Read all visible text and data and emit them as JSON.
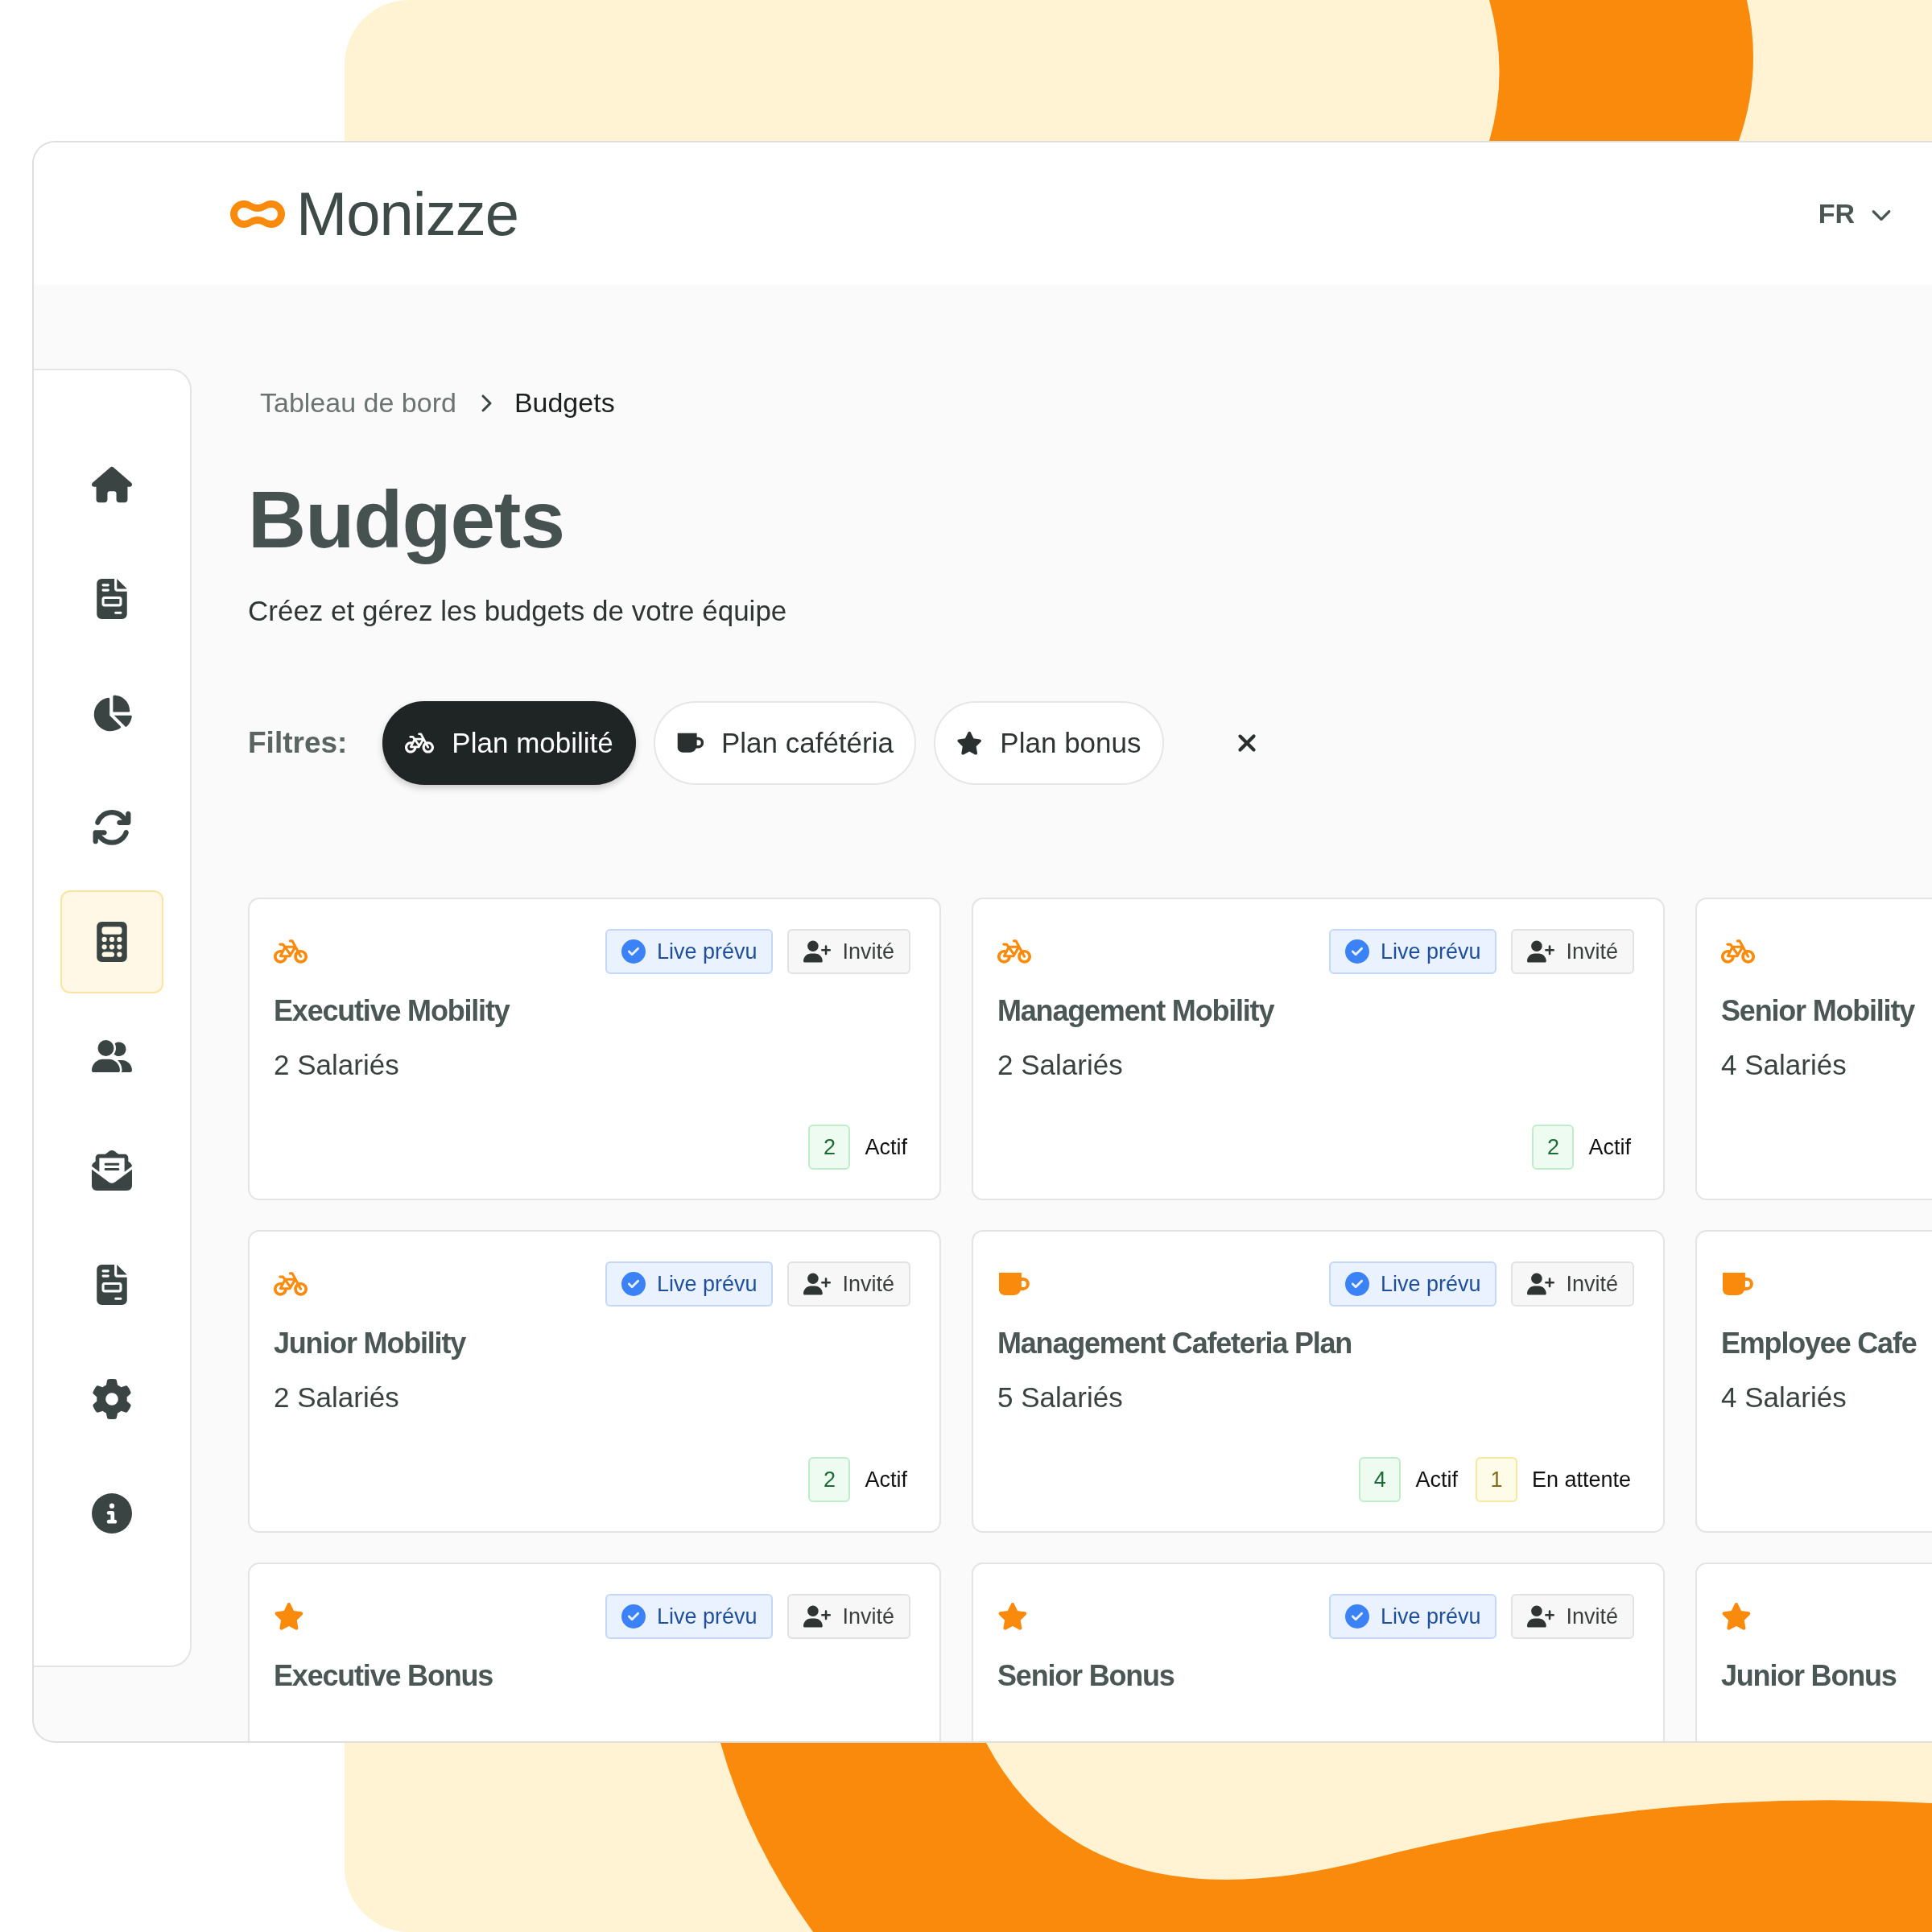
{
  "header": {
    "logo": "Monizze",
    "language": "FR"
  },
  "sidebar": {
    "items": [
      {
        "selected": false
      },
      {
        "selected": false
      },
      {
        "selected": false
      },
      {
        "selected": false
      },
      {
        "selected": true
      },
      {
        "selected": false
      },
      {
        "selected": false
      },
      {
        "selected": false
      },
      {
        "selected": false
      },
      {
        "selected": false
      }
    ]
  },
  "breadcrumb": [
    "Tableau de bord",
    "Budgets"
  ],
  "title": "Budgets",
  "subtitle": "Créez et gérez les budgets de votre équipe",
  "filters": {
    "label": "Filtres:",
    "items": [
      {
        "label": "Plan mobilité",
        "kind": "mobility",
        "selected": true
      },
      {
        "label": "Plan cafétéria",
        "kind": "cafeteria",
        "selected": false
      },
      {
        "label": "Plan bonus",
        "kind": "bonus",
        "selected": false
      }
    ]
  },
  "cards": [
    {
      "kind": "mobility",
      "title": "Executive Mobility",
      "employees": "2 Salariés",
      "badges": [
        {
          "label": "Live prévu",
          "kind": "live"
        },
        {
          "label": "Invité",
          "kind": "invite"
        }
      ],
      "statuses": [
        {
          "count": "2",
          "label": "Actif",
          "kind": "active"
        }
      ]
    },
    {
      "kind": "mobility",
      "title": "Management Mobility",
      "employees": "2 Salariés",
      "badges": [
        {
          "label": "Live prévu",
          "kind": "live"
        },
        {
          "label": "Invité",
          "kind": "invite"
        }
      ],
      "statuses": [
        {
          "count": "2",
          "label": "Actif",
          "kind": "active"
        }
      ]
    },
    {
      "kind": "mobility",
      "title": "Senior Mobility",
      "employees": "4 Salariés"
    },
    {
      "kind": "mobility",
      "title": "Junior Mobility",
      "employees": "2 Salariés",
      "badges": [
        {
          "label": "Live prévu",
          "kind": "live"
        },
        {
          "label": "Invité",
          "kind": "invite"
        }
      ],
      "statuses": [
        {
          "count": "2",
          "label": "Actif",
          "kind": "active"
        }
      ]
    },
    {
      "kind": "cafeteria",
      "title": "Management Cafeteria Plan",
      "employees": "5 Salariés",
      "badges": [
        {
          "label": "Live prévu",
          "kind": "live"
        },
        {
          "label": "Invité",
          "kind": "invite"
        }
      ],
      "statuses": [
        {
          "count": "4",
          "label": "Actif",
          "kind": "active"
        },
        {
          "count": "1",
          "label": "En attente",
          "kind": "pending"
        }
      ]
    },
    {
      "kind": "cafeteria",
      "title": "Employee Cafe",
      "employees": "4 Salariés"
    },
    {
      "kind": "bonus",
      "title": "Executive Bonus",
      "badges": [
        {
          "label": "Live prévu",
          "kind": "live"
        },
        {
          "label": "Invité",
          "kind": "invite"
        }
      ]
    },
    {
      "kind": "bonus",
      "title": "Senior Bonus",
      "badges": [
        {
          "label": "Live prévu",
          "kind": "live"
        },
        {
          "label": "Invité",
          "kind": "invite"
        }
      ]
    },
    {
      "kind": "bonus",
      "title": "Junior Bonus"
    }
  ]
}
